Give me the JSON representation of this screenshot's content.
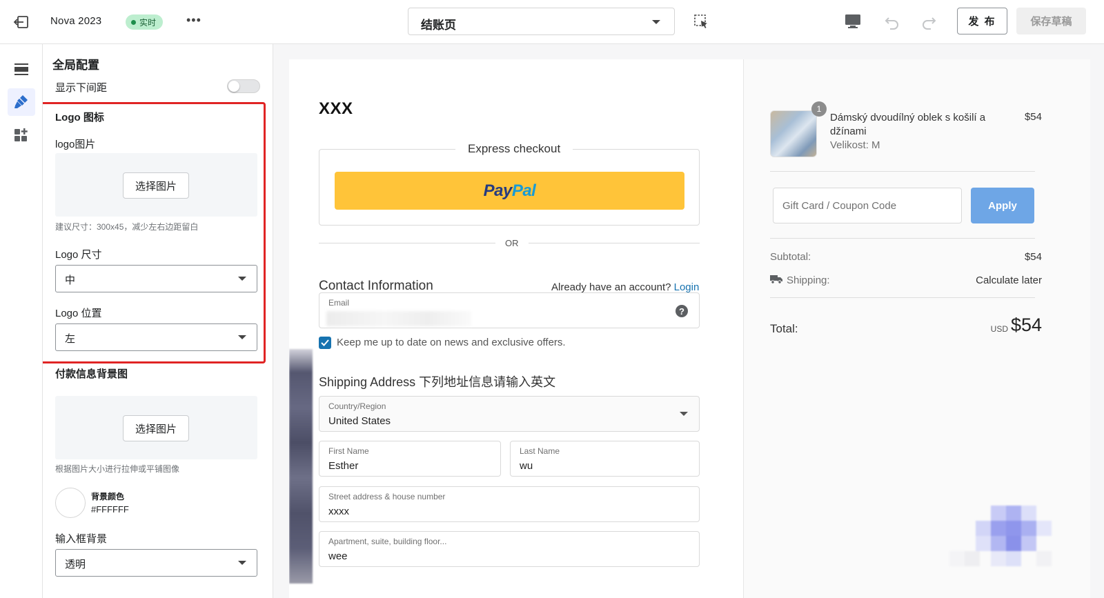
{
  "topbar": {
    "app_name": "Nova 2023",
    "live_badge": "实时",
    "page_select": "结账页",
    "publish_label": "发 布",
    "save_label": "保存草稿"
  },
  "panel": {
    "title": "全局配置",
    "bottom_spacing_label": "显示下间距",
    "bottom_spacing_on": false,
    "logo_section_title": "Logo 图标",
    "logo_image_label": "logo图片",
    "choose_image_label": "选择图片",
    "logo_hint": "建议尺寸：300x45，减少左右边距留白",
    "logo_size_label": "Logo 尺寸",
    "logo_size_value": "中",
    "logo_position_label": "Logo 位置",
    "logo_position_value": "左",
    "payment_bg_title": "付款信息背景图",
    "payment_bg_choose": "选择图片",
    "payment_bg_hint": "根据图片大小进行拉伸或平铺图像",
    "bg_color_label": "背景颜色",
    "bg_color_value": "#FFFFFF",
    "input_bg_label": "输入框背景",
    "input_bg_value": "透明"
  },
  "preview": {
    "store_logo": "XXX",
    "express_checkout": "Express checkout",
    "paypal_pay": "Pay",
    "paypal_pal": "Pal",
    "or": "OR",
    "contact_title": "Contact Information",
    "account_question": "Already have an account?",
    "login": "Login",
    "email_label": "Email",
    "newsletter": "Keep me up to date on news and exclusive offers.",
    "newsletter_checked": true,
    "shipping_title": "Shipping Address 下列地址信息请输入英文",
    "country_label": "Country/Region",
    "country_value": "United States",
    "first_name_label": "First Name",
    "first_name_value": "Esther",
    "last_name_label": "Last Name",
    "last_name_value": "wu",
    "street_label": "Street address & house number",
    "street_value": "xxxx",
    "apartment_label": "Apartment, suite, building floor...",
    "apartment_value": "wee"
  },
  "summary": {
    "qty": "1",
    "product_name": "Dámský dvoudílný oblek s košilí a džínami",
    "product_variant": "Velikost: M",
    "product_price": "$54",
    "coupon_placeholder": "Gift Card / Coupon Code",
    "apply_label": "Apply",
    "subtotal_label": "Subtotal:",
    "subtotal_value": "$54",
    "shipping_label": "Shipping:",
    "shipping_value": "Calculate later",
    "total_label": "Total:",
    "total_currency": "USD",
    "total_amount": "$54"
  },
  "colors": {
    "accent": "#1773b0",
    "paypal_yellow": "#ffc439",
    "apply_blue": "#6ea6e6",
    "highlight_red": "#e02424",
    "live_green": "#bdeecf"
  },
  "icons": [
    "exit-icon",
    "more-icon",
    "select-tool-icon",
    "desktop-icon",
    "undo-icon",
    "redo-icon",
    "sections-icon",
    "theme-brush-icon",
    "apps-icon",
    "help-icon",
    "truck-icon",
    "check-icon"
  ]
}
